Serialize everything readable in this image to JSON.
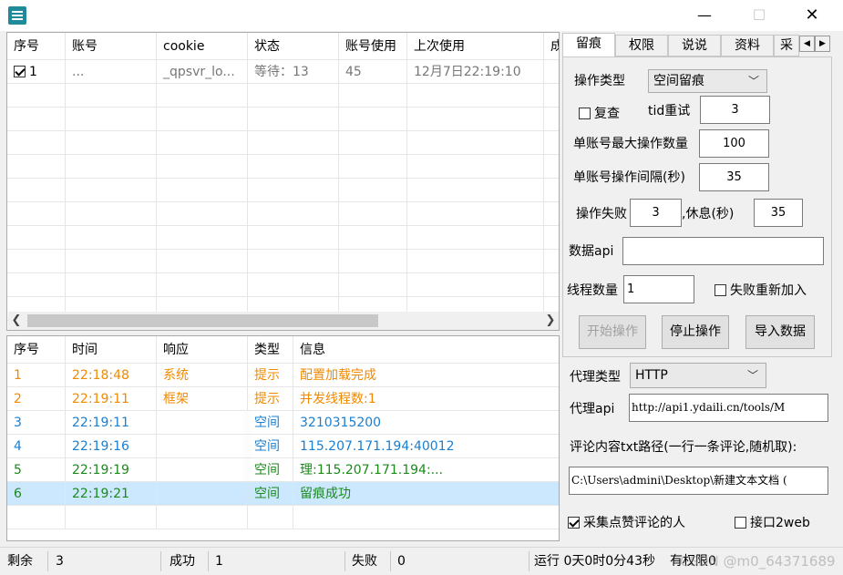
{
  "window": {
    "min_glyph": "—",
    "max_glyph": "☐",
    "close_glyph": "✕"
  },
  "accounts": {
    "columns": [
      "序号",
      "账号",
      "cookie",
      "状态",
      "账号使用",
      "上次使用",
      "成"
    ],
    "rows": [
      {
        "checked": true,
        "index": "1",
        "account": "",
        "account_suffix": "...",
        "cookie": "_qpsvr_lo...",
        "status": "等待：13",
        "usage": "45",
        "last_used": "12月7日22:19:10"
      }
    ]
  },
  "log": {
    "columns": [
      "序号",
      "时间",
      "响应",
      "类型",
      "信息"
    ],
    "colors": {
      "orange": "#f08a00",
      "blue": "#1a7fd0",
      "green": "#1b8a1b"
    },
    "rows": [
      {
        "index": "1",
        "time": "22:18:48",
        "response": "系统",
        "type": "提示",
        "info": "配置加载完成",
        "color": "orange",
        "selected": false
      },
      {
        "index": "2",
        "time": "22:19:11",
        "response": "框架",
        "type": "提示",
        "info": "并发线程数:1",
        "color": "orange",
        "selected": false
      },
      {
        "index": "3",
        "time": "22:19:11",
        "response": "",
        "type": "空间",
        "info": "3210315200",
        "color": "blue",
        "selected": false
      },
      {
        "index": "4",
        "time": "22:19:16",
        "response": "",
        "type": "空间",
        "info": "115.207.171.194:40012",
        "color": "blue",
        "selected": false
      },
      {
        "index": "5",
        "time": "22:19:19",
        "response": "",
        "type": "空间",
        "info": "理:115.207.171.194:...",
        "color": "green",
        "selected": false
      },
      {
        "index": "6",
        "time": "22:19:21",
        "response": "",
        "type": "空间",
        "info": "留痕成功",
        "color": "green",
        "selected": true
      }
    ]
  },
  "tabs": [
    "留痕",
    "权限",
    "说说",
    "资料",
    "采"
  ],
  "tab_spin": {
    "left": "◀",
    "right": "▶"
  },
  "ops": {
    "op_type_label": "操作类型",
    "op_type_value": "空间留痕",
    "recheck_label": "复查",
    "recheck_checked": false,
    "tid_retry_label": "tid重试",
    "tid_retry_value": "3",
    "max_ops_label": "单账号最大操作数量",
    "max_ops_value": "100",
    "interval_label": "单账号操作间隔(秒)",
    "interval_value": "35",
    "fail_label": "操作失败",
    "fail_value": "3",
    "rest_label": ",休息(秒)",
    "rest_value": "35",
    "data_api_label": "数据api",
    "data_api_value": "",
    "threads_label": "线程数量",
    "threads_value": "1",
    "requeue_label": "失败重新加入",
    "requeue_checked": false,
    "start_button": "开始操作",
    "stop_button": "停止操作",
    "import_button": "导入数据"
  },
  "proxy": {
    "type_label": "代理类型",
    "type_value": "HTTP",
    "api_label": "代理api",
    "api_value": "http://api1.ydaili.cn/tools/M",
    "comment_path_label": "评论内容txt路径(一行一条评论,随机取):",
    "comment_path_value": "C:\\Users\\admini\\Desktop\\新建文本文档 (",
    "collect_label": "采集点赞评论的人",
    "collect_checked": true,
    "port_label": "接口2web",
    "port_checked": false
  },
  "status": {
    "remain_label": "剩余",
    "remain_value": "3",
    "success_label": "成功",
    "success_value": "1",
    "fail_label": "失败",
    "fail_value": "0",
    "runtime": "运行 0天0时0分43秒",
    "rights": "有权限0",
    "watermark": "CSDN @m0_64371689"
  }
}
